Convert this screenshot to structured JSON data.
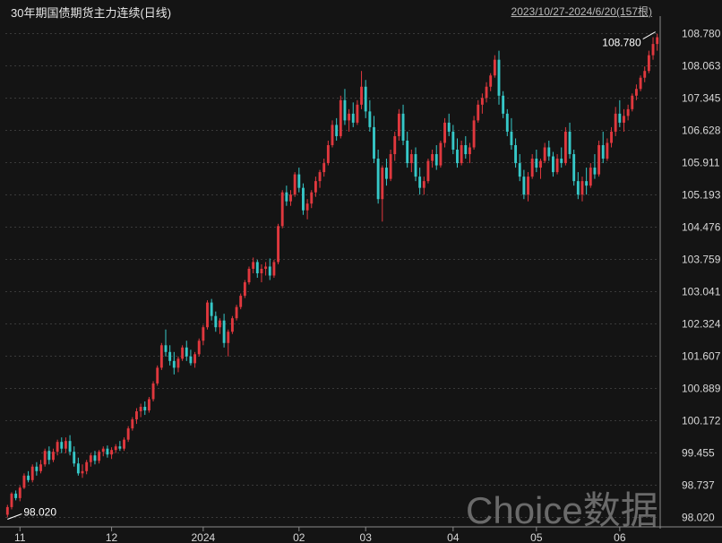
{
  "title": "30年期国债期货主力连续(日线)",
  "range_text": "2023/10/27-2024/6/20(157根)",
  "watermark": "Choice数据",
  "colors": {
    "background": "#141414",
    "grid": "#3a3a3a",
    "up": "#e0383e",
    "down": "#36c8c8",
    "axis_text": "#d8d8d8",
    "separator": "#8a8a8a"
  },
  "chart_data": {
    "type": "candlestick",
    "ylim": [
      97.85,
      109.05
    ],
    "y_ticks": [
      "108.780",
      "108.063",
      "107.345",
      "106.628",
      "105.911",
      "105.193",
      "104.476",
      "103.759",
      "103.041",
      "102.324",
      "101.607",
      "100.889",
      "100.172",
      "99.455",
      "98.737",
      "98.020"
    ],
    "x_ticks": [
      {
        "label": "11",
        "index": 3
      },
      {
        "label": "12",
        "index": 25
      },
      {
        "label": "2024",
        "index": 47
      },
      {
        "label": "02",
        "index": 70
      },
      {
        "label": "03",
        "index": 86
      },
      {
        "label": "04",
        "index": 107
      },
      {
        "label": "05",
        "index": 127
      },
      {
        "label": "06",
        "index": 147
      }
    ],
    "annotations": [
      {
        "text": "98.020",
        "index": 0,
        "value": 98.02
      },
      {
        "text": "108.780",
        "index": 156,
        "value": 108.78
      }
    ],
    "candles": [
      [
        98.08,
        98.3,
        98.02,
        98.25
      ],
      [
        98.25,
        98.58,
        98.2,
        98.55
      ],
      [
        98.55,
        98.62,
        98.4,
        98.45
      ],
      [
        98.45,
        98.72,
        98.38,
        98.68
      ],
      [
        98.68,
        99.0,
        98.65,
        98.95
      ],
      [
        98.95,
        99.05,
        98.8,
        98.85
      ],
      [
        98.85,
        99.2,
        98.8,
        99.15
      ],
      [
        99.15,
        99.25,
        98.95,
        99.05
      ],
      [
        99.05,
        99.3,
        99.0,
        99.2
      ],
      [
        99.2,
        99.55,
        99.15,
        99.5
      ],
      [
        99.5,
        99.6,
        99.2,
        99.3
      ],
      [
        99.3,
        99.55,
        99.25,
        99.48
      ],
      [
        99.48,
        99.75,
        99.4,
        99.7
      ],
      [
        99.7,
        99.8,
        99.45,
        99.55
      ],
      [
        99.55,
        99.8,
        99.45,
        99.72
      ],
      [
        99.72,
        99.85,
        99.4,
        99.48
      ],
      [
        99.48,
        99.6,
        99.15,
        99.22
      ],
      [
        99.22,
        99.35,
        98.95,
        99.0
      ],
      [
        99.0,
        99.2,
        98.9,
        99.05
      ],
      [
        99.05,
        99.3,
        98.98,
        99.25
      ],
      [
        99.25,
        99.45,
        99.15,
        99.4
      ],
      [
        99.4,
        99.5,
        99.2,
        99.28
      ],
      [
        99.28,
        99.52,
        99.22,
        99.48
      ],
      [
        99.48,
        99.6,
        99.38,
        99.55
      ],
      [
        99.55,
        99.62,
        99.35,
        99.42
      ],
      [
        99.42,
        99.58,
        99.32,
        99.52
      ],
      [
        99.52,
        99.65,
        99.45,
        99.6
      ],
      [
        99.6,
        99.72,
        99.5,
        99.55
      ],
      [
        99.55,
        99.8,
        99.5,
        99.75
      ],
      [
        99.75,
        100.05,
        99.7,
        100.0
      ],
      [
        100.0,
        100.25,
        99.95,
        100.2
      ],
      [
        100.2,
        100.45,
        100.1,
        100.38
      ],
      [
        100.38,
        100.55,
        100.25,
        100.48
      ],
      [
        100.48,
        100.6,
        100.3,
        100.4
      ],
      [
        100.4,
        100.7,
        100.35,
        100.65
      ],
      [
        100.65,
        101.05,
        100.6,
        101.0
      ],
      [
        101.0,
        101.4,
        100.95,
        101.35
      ],
      [
        101.35,
        101.9,
        101.3,
        101.85
      ],
      [
        101.85,
        102.2,
        101.6,
        101.7
      ],
      [
        101.7,
        101.85,
        101.4,
        101.5
      ],
      [
        101.5,
        101.7,
        101.2,
        101.35
      ],
      [
        101.35,
        101.6,
        101.25,
        101.55
      ],
      [
        101.55,
        101.85,
        101.5,
        101.8
      ],
      [
        101.8,
        101.95,
        101.5,
        101.6
      ],
      [
        101.6,
        101.75,
        101.4,
        101.45
      ],
      [
        101.45,
        101.7,
        101.35,
        101.65
      ],
      [
        101.65,
        102.0,
        101.6,
        101.95
      ],
      [
        101.95,
        102.3,
        101.85,
        102.25
      ],
      [
        102.25,
        102.85,
        102.2,
        102.8
      ],
      [
        102.8,
        102.88,
        102.4,
        102.5
      ],
      [
        102.5,
        102.6,
        102.15,
        102.25
      ],
      [
        102.25,
        102.45,
        102.1,
        102.4
      ],
      [
        102.4,
        102.55,
        101.8,
        101.9
      ],
      [
        101.9,
        102.2,
        101.6,
        102.15
      ],
      [
        102.15,
        102.5,
        102.1,
        102.45
      ],
      [
        102.45,
        102.75,
        102.4,
        102.7
      ],
      [
        102.7,
        103.0,
        102.65,
        102.95
      ],
      [
        102.95,
        103.3,
        102.9,
        103.25
      ],
      [
        103.25,
        103.6,
        103.2,
        103.55
      ],
      [
        103.55,
        103.8,
        103.45,
        103.7
      ],
      [
        103.7,
        103.75,
        103.35,
        103.45
      ],
      [
        103.45,
        103.65,
        103.25,
        103.55
      ],
      [
        103.55,
        103.7,
        103.4,
        103.6
      ],
      [
        103.6,
        103.78,
        103.3,
        103.4
      ],
      [
        103.4,
        103.75,
        103.35,
        103.7
      ],
      [
        103.7,
        104.55,
        103.65,
        104.5
      ],
      [
        104.5,
        105.3,
        104.45,
        105.25
      ],
      [
        105.25,
        105.4,
        104.95,
        105.05
      ],
      [
        105.05,
        105.3,
        104.95,
        105.2
      ],
      [
        105.2,
        105.7,
        105.15,
        105.65
      ],
      [
        105.65,
        105.8,
        105.25,
        105.35
      ],
      [
        105.35,
        105.45,
        104.75,
        104.85
      ],
      [
        104.85,
        105.1,
        104.65,
        105.0
      ],
      [
        105.0,
        105.3,
        104.9,
        105.25
      ],
      [
        105.25,
        105.6,
        105.15,
        105.5
      ],
      [
        105.5,
        105.75,
        105.35,
        105.7
      ],
      [
        105.7,
        106.0,
        105.6,
        105.9
      ],
      [
        105.9,
        106.4,
        105.85,
        106.3
      ],
      [
        106.3,
        106.85,
        106.25,
        106.75
      ],
      [
        106.75,
        106.9,
        106.4,
        106.5
      ],
      [
        106.5,
        107.4,
        106.45,
        107.3
      ],
      [
        107.3,
        107.55,
        106.75,
        106.85
      ],
      [
        106.85,
        107.1,
        106.6,
        107.0
      ],
      [
        107.0,
        107.25,
        106.7,
        106.8
      ],
      [
        106.8,
        107.3,
        106.75,
        107.2
      ],
      [
        107.2,
        107.95,
        107.1,
        107.6
      ],
      [
        107.6,
        107.75,
        106.9,
        107.05
      ],
      [
        107.05,
        107.3,
        106.6,
        106.7
      ],
      [
        106.7,
        106.95,
        105.9,
        106.0
      ],
      [
        106.0,
        106.2,
        105.0,
        105.1
      ],
      [
        105.1,
        105.85,
        104.6,
        105.8
      ],
      [
        105.8,
        106.0,
        105.4,
        105.55
      ],
      [
        105.55,
        106.2,
        105.5,
        106.1
      ],
      [
        106.1,
        106.6,
        105.95,
        106.5
      ],
      [
        106.5,
        107.1,
        106.4,
        107.0
      ],
      [
        107.0,
        107.2,
        106.3,
        106.4
      ],
      [
        106.4,
        106.6,
        105.8,
        105.9
      ],
      [
        105.9,
        106.2,
        105.7,
        106.1
      ],
      [
        106.1,
        106.25,
        105.5,
        105.6
      ],
      [
        105.6,
        105.8,
        105.2,
        105.35
      ],
      [
        105.35,
        105.6,
        105.2,
        105.5
      ],
      [
        105.5,
        106.0,
        105.45,
        105.95
      ],
      [
        105.95,
        106.2,
        105.8,
        106.1
      ],
      [
        106.1,
        106.3,
        105.75,
        105.85
      ],
      [
        105.85,
        106.4,
        105.8,
        106.35
      ],
      [
        106.35,
        106.9,
        106.25,
        106.8
      ],
      [
        106.8,
        107.0,
        106.5,
        106.6
      ],
      [
        106.6,
        106.75,
        106.1,
        106.2
      ],
      [
        106.2,
        106.45,
        105.8,
        105.9
      ],
      [
        105.9,
        106.4,
        105.85,
        106.3
      ],
      [
        106.3,
        106.5,
        106.0,
        106.1
      ],
      [
        106.1,
        106.35,
        105.9,
        106.25
      ],
      [
        106.25,
        106.95,
        106.2,
        106.85
      ],
      [
        106.85,
        107.3,
        106.8,
        107.2
      ],
      [
        107.2,
        107.45,
        107.0,
        107.35
      ],
      [
        107.35,
        107.7,
        107.25,
        107.6
      ],
      [
        107.6,
        107.9,
        107.5,
        107.85
      ],
      [
        107.85,
        108.3,
        107.8,
        108.2
      ],
      [
        108.2,
        108.4,
        107.2,
        107.4
      ],
      [
        107.4,
        107.5,
        106.9,
        107.0
      ],
      [
        107.0,
        107.1,
        106.5,
        106.6
      ],
      [
        106.6,
        106.9,
        106.2,
        106.3
      ],
      [
        106.3,
        106.45,
        105.8,
        105.9
      ],
      [
        105.9,
        106.1,
        105.5,
        105.6
      ],
      [
        105.6,
        105.75,
        105.1,
        105.2
      ],
      [
        105.2,
        105.7,
        105.05,
        105.6
      ],
      [
        105.6,
        106.1,
        105.55,
        106.0
      ],
      [
        106.0,
        106.2,
        105.7,
        105.8
      ],
      [
        105.8,
        106.0,
        105.55,
        105.95
      ],
      [
        105.95,
        106.35,
        105.9,
        106.25
      ],
      [
        106.25,
        106.4,
        105.95,
        106.05
      ],
      [
        106.05,
        106.15,
        105.6,
        105.7
      ],
      [
        105.7,
        106.1,
        105.65,
        106.0
      ],
      [
        106.0,
        106.25,
        105.8,
        105.9
      ],
      [
        105.9,
        106.7,
        105.85,
        106.6
      ],
      [
        106.6,
        106.8,
        106.0,
        106.1
      ],
      [
        106.1,
        106.2,
        105.4,
        105.5
      ],
      [
        105.5,
        105.7,
        105.1,
        105.2
      ],
      [
        105.2,
        105.6,
        105.05,
        105.5
      ],
      [
        105.5,
        105.8,
        105.2,
        105.4
      ],
      [
        105.4,
        105.9,
        105.35,
        105.8
      ],
      [
        105.8,
        106.1,
        105.55,
        105.65
      ],
      [
        105.65,
        106.4,
        105.6,
        106.3
      ],
      [
        106.3,
        106.6,
        105.9,
        106.0
      ],
      [
        106.0,
        106.45,
        105.95,
        106.35
      ],
      [
        106.35,
        106.7,
        106.25,
        106.6
      ],
      [
        106.6,
        107.15,
        106.5,
        107.0
      ],
      [
        107.0,
        107.3,
        106.7,
        106.8
      ],
      [
        106.8,
        107.1,
        106.6,
        106.95
      ],
      [
        106.95,
        107.2,
        106.85,
        107.1
      ],
      [
        107.1,
        107.45,
        107.05,
        107.4
      ],
      [
        107.4,
        107.65,
        107.3,
        107.55
      ],
      [
        107.55,
        107.85,
        107.5,
        107.8
      ],
      [
        107.8,
        108.05,
        107.7,
        107.95
      ],
      [
        107.95,
        108.4,
        107.9,
        108.3
      ],
      [
        108.3,
        108.7,
        108.2,
        108.55
      ],
      [
        108.55,
        108.78,
        108.4,
        108.7
      ]
    ]
  }
}
